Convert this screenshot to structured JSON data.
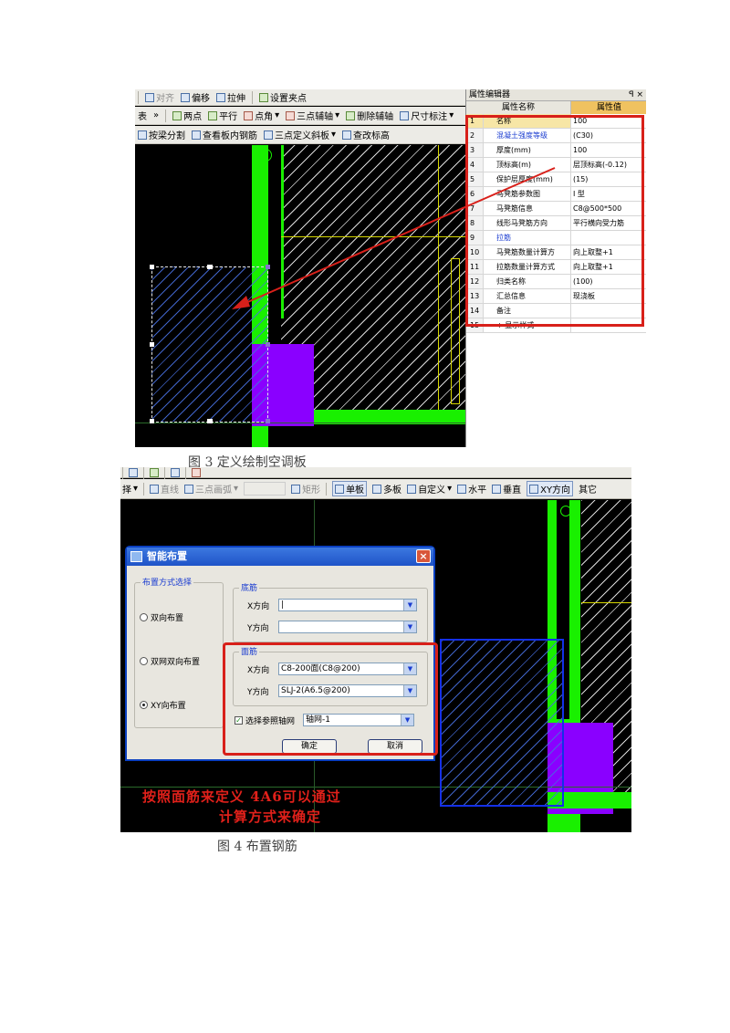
{
  "figure3": {
    "toolbar_row1": {
      "align": "对齐",
      "offset": "偏移",
      "stretch": "拉伸",
      "set_grip": "设置夹点"
    },
    "toolbar_row2": {
      "left": "表",
      "more": "»",
      "two_point": "两点",
      "parallel": "平行",
      "point_angle": "点角",
      "three_point_axis": "三点辅轴",
      "delete_axis": "删除辅轴",
      "dimension": "尺寸标注"
    },
    "toolbar_row3": {
      "split_by_beam": "按梁分割",
      "view_rebar": "查看板内钢筋",
      "three_point_slope": "三点定义斜板",
      "modify_elevation": "查改标高"
    },
    "property_panel": {
      "title": "属性编辑器",
      "title_buttons": "ꟼ ×",
      "col_name": "属性名称",
      "col_value": "属性值",
      "rows": [
        {
          "no": "1",
          "name": "名称",
          "value": "100",
          "blue": false
        },
        {
          "no": "2",
          "name": "混凝土强度等级",
          "value": "(C30)",
          "blue": true
        },
        {
          "no": "3",
          "name": "厚度(mm)",
          "value": "100",
          "blue": false
        },
        {
          "no": "4",
          "name": "顶标高(m)",
          "value": "层顶标高(-0.12)",
          "blue": false
        },
        {
          "no": "5",
          "name": "保护层厚度(mm)",
          "value": "(15)",
          "blue": false
        },
        {
          "no": "6",
          "name": "马凳筋参数图",
          "value": "I 型",
          "blue": false
        },
        {
          "no": "7",
          "name": "马凳筋信息",
          "value": "C8@500*500",
          "blue": false
        },
        {
          "no": "8",
          "name": "线形马凳筋方向",
          "value": "平行横向受力筋",
          "blue": false
        },
        {
          "no": "9",
          "name": "拉筋",
          "value": "",
          "blue": true
        },
        {
          "no": "10",
          "name": "马凳筋数量计算方",
          "value": "向上取整+1",
          "blue": false
        },
        {
          "no": "11",
          "name": "拉筋数量计算方式",
          "value": "向上取整+1",
          "blue": false
        },
        {
          "no": "12",
          "name": "归类名称",
          "value": "(100)",
          "blue": false
        },
        {
          "no": "13",
          "name": "汇总信息",
          "value": "现浇板",
          "blue": false
        },
        {
          "no": "14",
          "name": "备注",
          "value": "",
          "blue": false
        },
        {
          "no": "15",
          "name": "+ 显示样式",
          "value": "",
          "blue": false
        }
      ]
    },
    "caption": "图 3 定义绘制空调板"
  },
  "figure4": {
    "toolbar_row2": {
      "select": "择",
      "line": "直线",
      "three_point_arc": "三点画弧",
      "rect": "矩形",
      "single_slab": "单板",
      "multi_slab": "多板",
      "custom": "自定义",
      "horizontal": "水平",
      "vertical": "垂直",
      "xy_direction": "XY方向",
      "other": "其它"
    },
    "dialog": {
      "title": "智能布置",
      "close": "×",
      "layout_group": "布置方式选择",
      "options": [
        {
          "label": "双向布置",
          "selected": false
        },
        {
          "label": "双网双向布置",
          "selected": false
        },
        {
          "label": "XY向布置",
          "selected": true
        }
      ],
      "bottom_group": "底筋",
      "bottom_x_label": "X方向",
      "bottom_x_value": "|",
      "bottom_y_label": "Y方向",
      "bottom_y_value": "",
      "top_group": "面筋",
      "top_x_label": "X方向",
      "top_x_value": "C8-200面(C8@200)",
      "top_y_label": "Y方向",
      "top_y_value": "SLJ-2(A6.5@200)",
      "ref_checkbox_label": "选择参照轴网",
      "ref_checked": true,
      "ref_value": "轴网-1",
      "ok": "确定",
      "cancel": "取消"
    },
    "annotation_line1": "按照面筋来定义 4A6可以通过",
    "annotation_line2": "计算方式来确定",
    "caption": "图 4 布置钢筋"
  },
  "colors": {
    "cad_green": "#19f000",
    "cad_purple": "#8a00ff",
    "cad_yellow": "#d8d800",
    "highlight_red": "#d8201a",
    "select_blue": "#1430e8"
  }
}
